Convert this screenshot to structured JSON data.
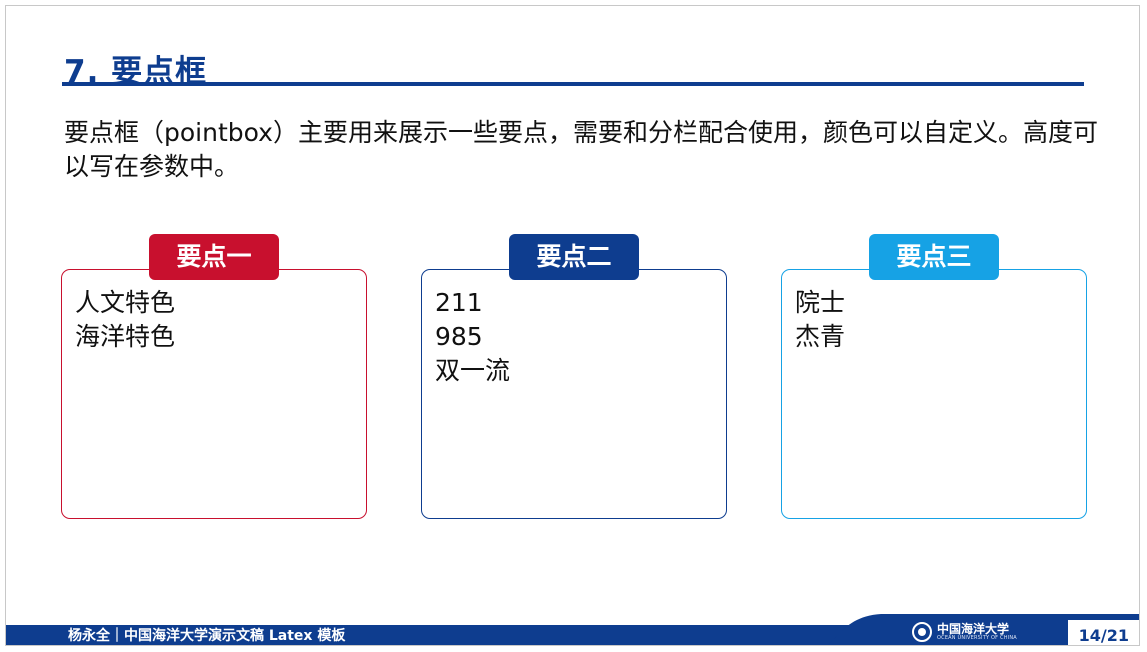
{
  "slide": {
    "title": "7. 要点框",
    "body": "要点框（pointbox）主要用来展示一些要点，需要和分栏配合使用，颜色可以自定义。高度可以写在参数中。"
  },
  "pointboxes": [
    {
      "tag": "要点一",
      "color": "#c8102e",
      "items": [
        "人文特色",
        "海洋特色"
      ]
    },
    {
      "tag": "要点二",
      "color": "#0e3d8f",
      "items": [
        "211",
        "985",
        "双一流"
      ]
    },
    {
      "tag": "要点三",
      "color": "#16a2e5",
      "items": [
        "院士",
        "杰青"
      ]
    }
  ],
  "footer": {
    "text": "杨永全｜中国海洋大学演示文稿 Latex 模板",
    "page": "14/21",
    "logo_cn": "中国海洋大学",
    "logo_en": "OCEAN UNIVERSITY OF CHINA",
    "bar_color": "#0e3d8f"
  }
}
